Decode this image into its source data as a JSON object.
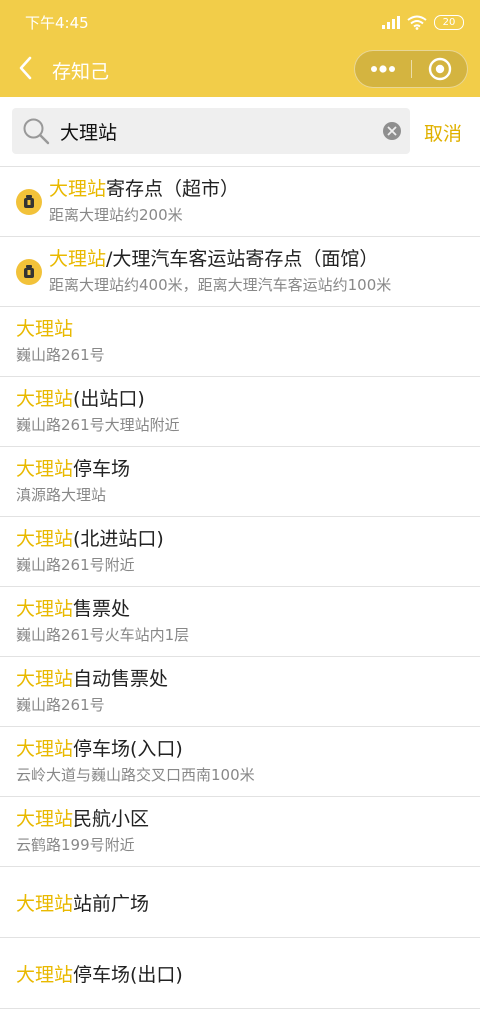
{
  "status_bar": {
    "time": "下午4:45",
    "battery": "20"
  },
  "nav": {
    "title": "存知己"
  },
  "search": {
    "value": "大理站",
    "cancel_label": "取消"
  },
  "results": [
    {
      "highlight": "大理站",
      "rest": "寄存点（超市）",
      "address": "距离大理站约200米",
      "has_icon": true
    },
    {
      "highlight": "大理站",
      "rest": "/大理汽车客运站寄存点（面馆）",
      "address": "距离大理站约400米，距离大理汽车客运站约100米",
      "has_icon": true
    },
    {
      "highlight": "大理站",
      "rest": "",
      "address": "巍山路261号"
    },
    {
      "highlight": "大理站",
      "rest": "(出站口)",
      "address": "巍山路261号大理站附近"
    },
    {
      "highlight": "大理站",
      "rest": "停车场",
      "address": "滇源路大理站"
    },
    {
      "highlight": "大理站",
      "rest": "(北进站口)",
      "address": "巍山路261号附近"
    },
    {
      "highlight": "大理站",
      "rest": "售票处",
      "address": "巍山路261号火车站内1层"
    },
    {
      "highlight": "大理站",
      "rest": "自动售票处",
      "address": "巍山路261号"
    },
    {
      "highlight": "大理站",
      "rest": "停车场(入口)",
      "address": "云岭大道与巍山路交叉口西南100米"
    },
    {
      "highlight": "大理站",
      "rest": "民航小区",
      "address": "云鹤路199号附近"
    },
    {
      "highlight": "大理站",
      "rest": "站前广场",
      "address": ""
    },
    {
      "highlight": "大理站",
      "rest": "停车场(出口)",
      "address": ""
    }
  ]
}
